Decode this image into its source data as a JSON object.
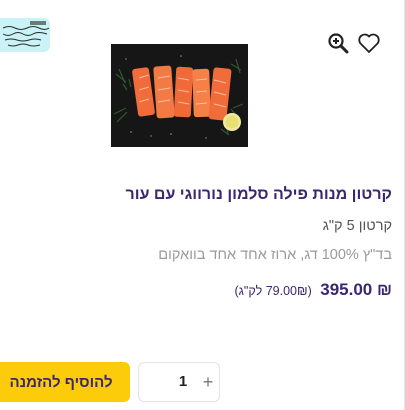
{
  "product": {
    "title": "קרטון מנות פילה סלמון נורווגי עם עור",
    "subtitle": "קרטון 5 ק\"ג",
    "description": "בד\"ץ 100% דג, ארוז אחד אחד בוואקום",
    "price": "₪ 395.00",
    "unit_price": "(79.00₪ לק\"ג)"
  },
  "cart": {
    "quantity": "1",
    "plus_label": "+",
    "add_label": "להוסיף להזמנה"
  },
  "icons": {
    "wishlist": "heart-icon",
    "zoom": "zoom-in-icon",
    "certification": "kashrut-certificate-badge"
  },
  "colors": {
    "accent": "#3b2670",
    "button": "#fccb0a",
    "badge": "#c9f3f6"
  }
}
